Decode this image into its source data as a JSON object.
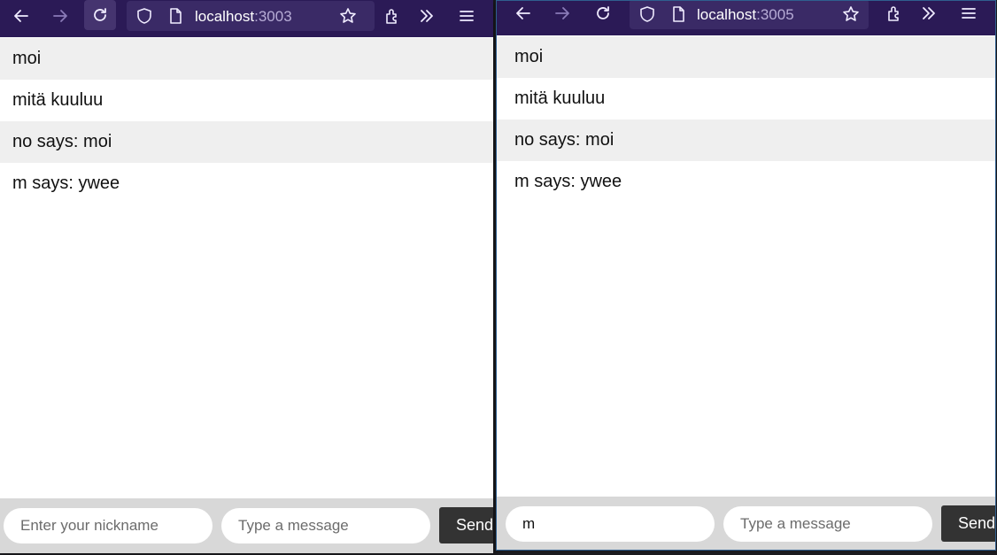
{
  "windows": [
    {
      "toolbar": {
        "url_host": "localhost",
        "url_port": ":3003",
        "icons": [
          "back-arrow-icon",
          "forward-arrow-icon",
          "reload-icon",
          "shield-icon",
          "page-icon",
          "star-icon",
          "extensions-icon",
          "overflow-chevrons-icon",
          "menu-icon"
        ]
      },
      "messages": [
        "moi",
        "mitä kuuluu",
        "no says: moi",
        "m says: ywee"
      ],
      "form": {
        "nickname_value": "",
        "nickname_placeholder": "Enter your nickname",
        "message_value": "",
        "message_placeholder": "Type a message",
        "send_label": "Send"
      }
    },
    {
      "toolbar": {
        "url_host": "localhost",
        "url_port": ":3005",
        "icons": [
          "back-arrow-icon",
          "forward-arrow-icon",
          "reload-icon",
          "shield-icon",
          "page-icon",
          "star-icon",
          "extensions-icon",
          "overflow-chevrons-icon",
          "menu-icon"
        ]
      },
      "messages": [
        "moi",
        "mitä kuuluu",
        "no says: moi",
        "m says: ywee"
      ],
      "form": {
        "nickname_value": "m",
        "nickname_placeholder": "Enter your nickname",
        "message_value": "",
        "message_placeholder": "Type a message",
        "send_label": "Send"
      }
    }
  ],
  "colors": {
    "toolbar_bg": "#2b1a56",
    "urlbar_bg": "#3a2a66",
    "form_bg": "#d8d8d8",
    "send_button_bg": "#333333",
    "message_alt_row": "#efefef"
  }
}
